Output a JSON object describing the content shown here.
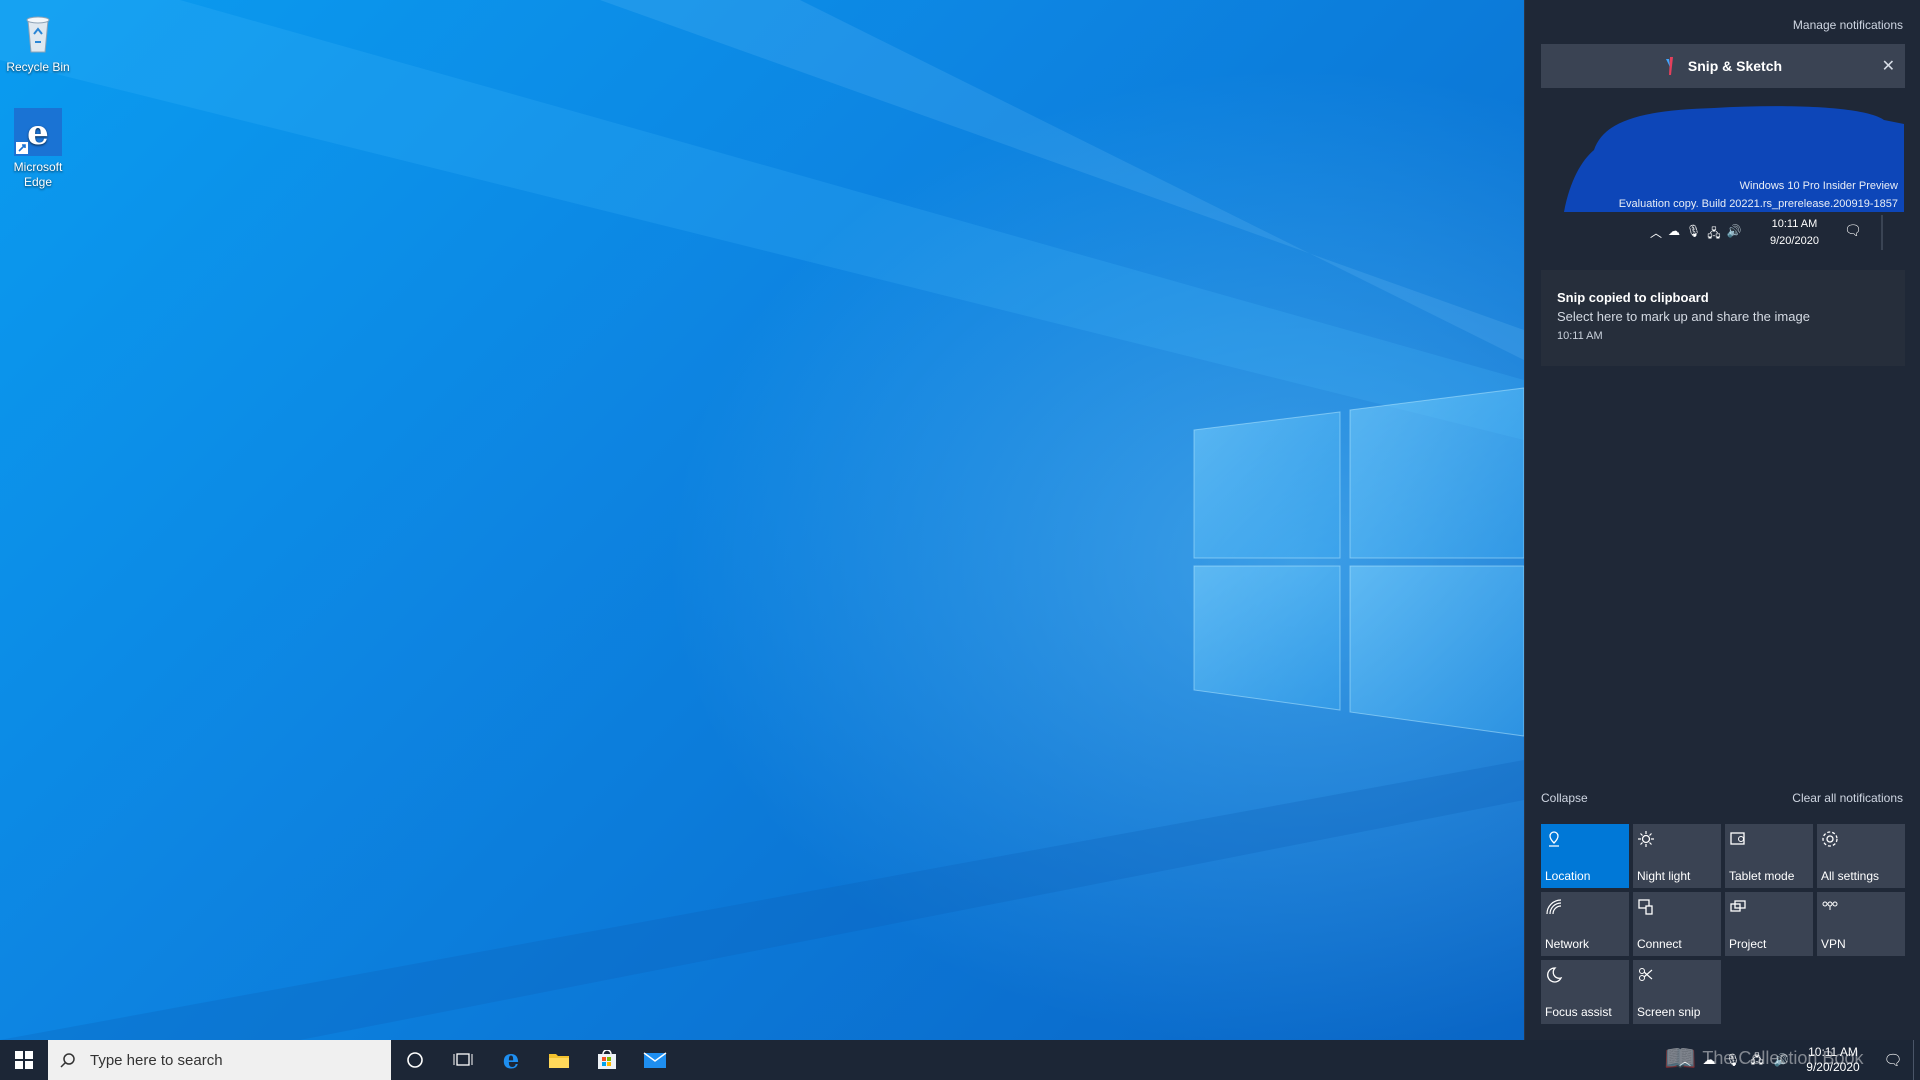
{
  "desktop": {
    "icons": [
      {
        "label": "Recycle Bin",
        "icon": "recycle-bin-icon"
      },
      {
        "label": "Microsoft Edge",
        "icon": "edge-icon"
      }
    ]
  },
  "taskbar": {
    "search_placeholder": "Type here to search",
    "clock_time": "10:11 AM",
    "clock_date": "9/20/2020",
    "apps": [
      "cortana-icon",
      "task-view-icon",
      "edge-icon",
      "file-explorer-icon",
      "store-icon",
      "mail-icon"
    ]
  },
  "action_center": {
    "manage_notifications": "Manage notifications",
    "app_name": "Snip & Sketch",
    "preview": {
      "line1": "Windows 10 Pro Insider Preview",
      "line2": "Evaluation copy. Build 20221.rs_prerelease.200919-1857",
      "time": "10:11 AM",
      "date": "9/20/2020"
    },
    "toast": {
      "title": "Snip copied to clipboard",
      "body": "Select here to mark up and share the image",
      "time": "10:11 AM"
    },
    "collapse": "Collapse",
    "clear_all": "Clear all notifications",
    "quick_actions": [
      {
        "label": "Location",
        "icon": "location-icon",
        "active": true
      },
      {
        "label": "Night light",
        "icon": "night-light-icon",
        "active": false
      },
      {
        "label": "Tablet mode",
        "icon": "tablet-mode-icon",
        "active": false
      },
      {
        "label": "All settings",
        "icon": "gear-icon",
        "active": false
      },
      {
        "label": "Network",
        "icon": "network-icon",
        "active": false
      },
      {
        "label": "Connect",
        "icon": "connect-icon",
        "active": false
      },
      {
        "label": "Project",
        "icon": "project-icon",
        "active": false
      },
      {
        "label": "VPN",
        "icon": "vpn-icon",
        "active": false
      },
      {
        "label": "Focus assist",
        "icon": "moon-icon",
        "active": false
      },
      {
        "label": "Screen snip",
        "icon": "screen-snip-icon",
        "active": false
      }
    ]
  },
  "watermark": "The Collection Book",
  "colors": {
    "accent": "#0078d7",
    "panel": "#1f2837",
    "tile": "#3a4353",
    "taskbar": "#1c2636"
  }
}
